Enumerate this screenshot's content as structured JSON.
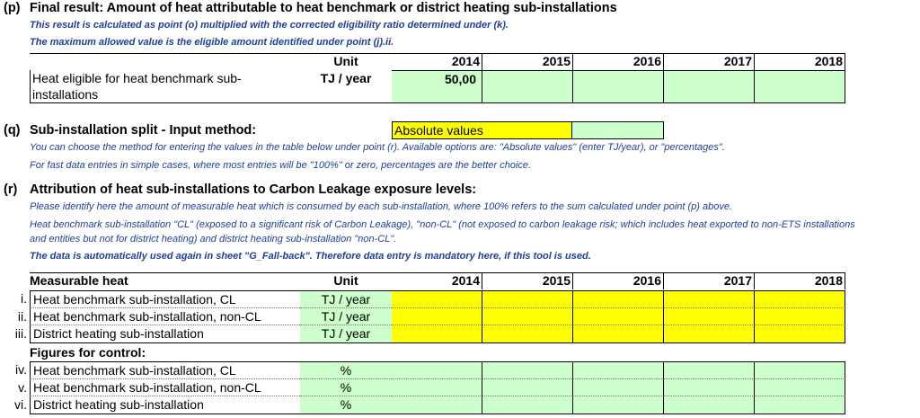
{
  "p": {
    "num": "(p)",
    "title": "Final result: Amount of heat attributable to heat benchmark or district heating sub-installations",
    "note1": "This result is calculated as point (o) multiplied with the corrected eligibility ratio determined under (k).",
    "note2": "The maximum allowed value is the eligible amount identified under point (j).ii.",
    "table": {
      "unit_header": "Unit",
      "years": [
        "2014",
        "2015",
        "2016",
        "2017",
        "2018"
      ],
      "row_label_1": "Heat eligible for heat benchmark sub-",
      "row_label_2": "installations",
      "unit": "TJ / year",
      "values": [
        "50,00",
        "",
        "",
        "",
        ""
      ]
    }
  },
  "q": {
    "num": "(q)",
    "title": "Sub-installation split - Input method:",
    "select_value": "Absolute values",
    "note1": "You can choose the method for entering the values in the table below under point (r). Available options are: \"Absolute values\" (enter TJ/year), or \"percentages\".",
    "note2": "For fast data entries in simple cases, where most entries will be \"100%\" or zero, percentages are the better choice."
  },
  "r": {
    "num": "(r)",
    "title": "Attribution of heat sub-installations to Carbon Leakage exposure levels:",
    "note1": "Please identify here the amount of measurable heat which is consumed by each sub-installation, where 100% refers to the sum calculated under point (p) above.",
    "note2a": "Heat benchmark sub-installation \"CL\" (exposed to a significant risk of Carbon Leakage), \"non-CL\" (not exposed to carbon leakage risk; which includes heat exported to non-ETS installations",
    "note2b": "and entities but not for district heating) and district heating sub-installation \"non-CL\".",
    "note3": "The data is automatically used again in sheet \"G_Fall-back\". Therefore data entry is mandatory here, if this tool is used.",
    "table": {
      "header_label": "Measurable heat",
      "unit_header": "Unit",
      "years": [
        "2014",
        "2015",
        "2016",
        "2017",
        "2018"
      ],
      "rows": [
        {
          "num": "i.",
          "label": "Heat benchmark sub-installation, CL",
          "unit": "TJ / year"
        },
        {
          "num": "ii.",
          "label": "Heat benchmark sub-installation, non-CL",
          "unit": "TJ / year"
        },
        {
          "num": "iii.",
          "label": "District heating sub-installation",
          "unit": "TJ / year"
        }
      ],
      "control_label": "Figures for control:",
      "control_rows": [
        {
          "num": "iv.",
          "label": "Heat benchmark sub-installation, CL",
          "unit": "%"
        },
        {
          "num": "v.",
          "label": "Heat benchmark sub-installation, non-CL",
          "unit": "%"
        },
        {
          "num": "vi.",
          "label": "District heating sub-installation",
          "unit": "%"
        }
      ]
    }
  },
  "colors": {
    "input": "#ffff00",
    "output": "#ccffcc",
    "note": "#1f3f99"
  }
}
